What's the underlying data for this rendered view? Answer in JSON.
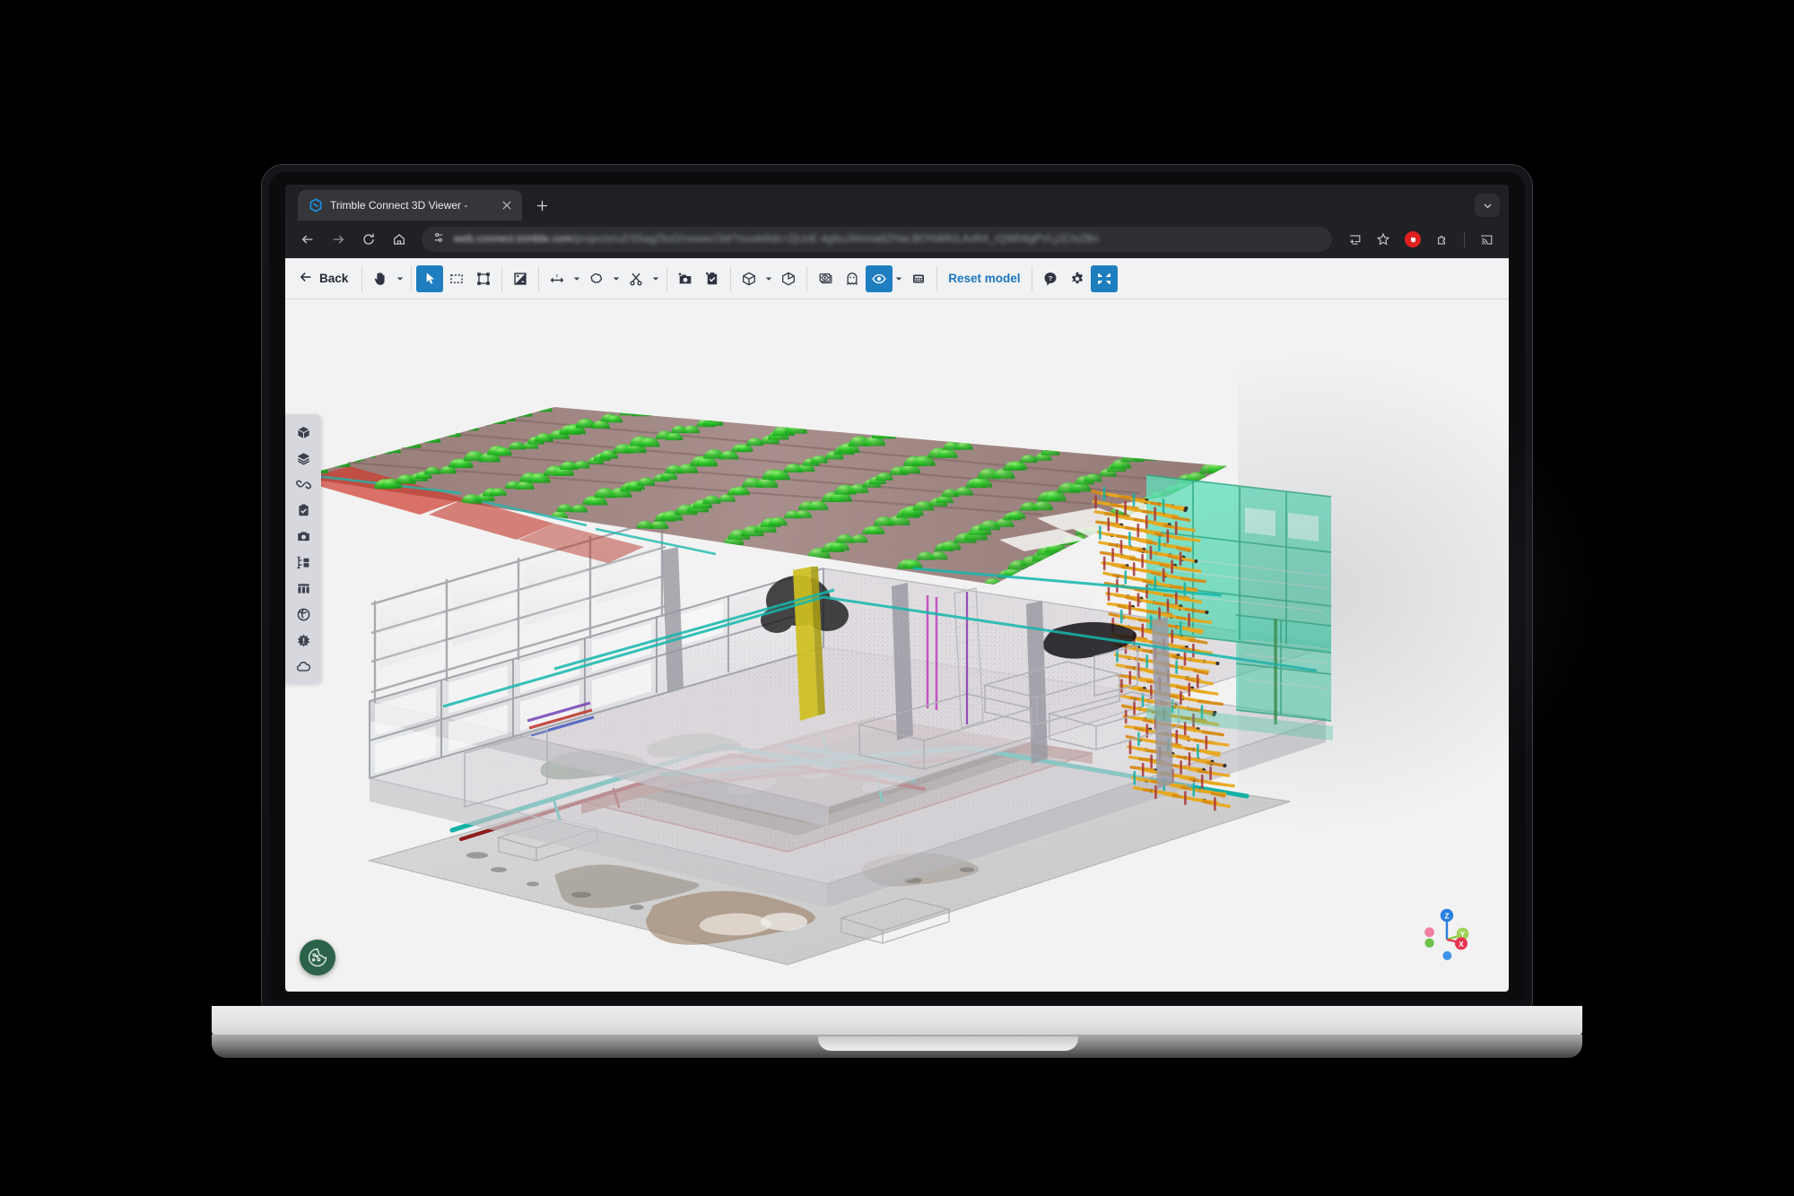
{
  "browser": {
    "tab": {
      "title": "Trimble Connect 3D Viewer -",
      "favicon_icon": "trimble-logo-icon",
      "close_icon": "close-icon"
    },
    "new_tab_label": "+",
    "tab_search_icon": "chevron-down-icon",
    "nav": {
      "back_icon": "arrow-left-icon",
      "forward_icon": "arrow-right-icon",
      "reload_icon": "reload-icon",
      "home_icon": "home-icon"
    },
    "address": {
      "site_settings_icon": "tune-icon",
      "url_domain": "web.connect.trimble.com",
      "url_path": "/projects/uZr55agZbzD/viewer/3d/?modelIds=ZjUoE-4g6uJAhmia6ZHaLBO%WKiLAvRA_rQWh6gPVLjJZJsZBn",
      "blurred": true
    },
    "actions": {
      "install_icon": "install-app-icon",
      "bookmark_icon": "star-icon",
      "extension_badge_icon": "extension-alert-icon",
      "extensions_icon": "puzzle-piece-icon",
      "cast_icon": "cast-icon"
    }
  },
  "toolbar": {
    "back_label": "Back",
    "back_icon": "arrow-left-icon",
    "reset_label": "Reset model",
    "groups": [
      {
        "name": "navigation",
        "items": [
          {
            "icon": "pan-hand-icon",
            "name": "pan-tool",
            "active": false,
            "caret": true
          }
        ]
      },
      {
        "name": "selection",
        "items": [
          {
            "icon": "cursor-arrow-icon",
            "name": "select-tool",
            "active": true,
            "caret": false
          },
          {
            "icon": "marquee-select-icon",
            "name": "rectangle-select-tool",
            "active": false,
            "caret": false
          },
          {
            "icon": "bounding-box-select-icon",
            "name": "box-select-tool",
            "active": false,
            "caret": false
          }
        ]
      },
      {
        "name": "appearance",
        "items": [
          {
            "icon": "contrast-icon",
            "name": "contrast-tool",
            "active": false,
            "caret": false
          }
        ]
      },
      {
        "name": "annotate",
        "items": [
          {
            "icon": "measure-icon",
            "name": "measure-tool",
            "active": false,
            "caret": true
          },
          {
            "icon": "markup-cloud-icon",
            "name": "markup-tool",
            "active": false,
            "caret": true
          },
          {
            "icon": "scissors-icon",
            "name": "clip-tool",
            "active": false,
            "caret": true
          }
        ]
      },
      {
        "name": "capture",
        "items": [
          {
            "icon": "add-photo-icon",
            "name": "create-view-button",
            "active": false,
            "caret": false
          },
          {
            "icon": "add-todo-icon",
            "name": "create-todo-button",
            "active": false,
            "caret": false
          }
        ]
      },
      {
        "name": "display-mode",
        "items": [
          {
            "icon": "wireframe-cube-icon",
            "name": "render-mode-tool",
            "active": false,
            "caret": true
          },
          {
            "icon": "solid-cube-icon",
            "name": "solid-mode-button",
            "active": false,
            "caret": false
          }
        ]
      },
      {
        "name": "visibility",
        "items": [
          {
            "icon": "layers-eye-icon",
            "name": "isolate-button",
            "active": false,
            "caret": false
          },
          {
            "icon": "ghost-icon",
            "name": "transparency-button",
            "active": false,
            "caret": false
          },
          {
            "icon": "eye-icon",
            "name": "visibility-tool",
            "active": true,
            "caret": true
          },
          {
            "icon": "grid-icon",
            "name": "point-cloud-grid-button",
            "active": false,
            "caret": false
          }
        ]
      },
      {
        "name": "utilities",
        "items": [
          {
            "icon": "help-icon",
            "name": "help-button",
            "active": false,
            "caret": false
          },
          {
            "icon": "gear-icon",
            "name": "settings-button",
            "active": false,
            "caret": false
          },
          {
            "icon": "fit-to-view-icon",
            "name": "fit-to-view-button",
            "active": true,
            "caret": false
          }
        ]
      }
    ]
  },
  "sidebar": {
    "items": [
      {
        "icon": "cube-icon",
        "name": "models-panel"
      },
      {
        "icon": "layers-icon",
        "name": "layers-panel"
      },
      {
        "icon": "link-icon",
        "name": "links-panel"
      },
      {
        "icon": "clipboard-check-icon",
        "name": "todos-panel"
      },
      {
        "icon": "camera-icon",
        "name": "views-panel"
      },
      {
        "icon": "folder-tree-icon",
        "name": "structure-panel"
      },
      {
        "icon": "table-columns-icon",
        "name": "properties-panel"
      },
      {
        "icon": "orbit-sphere-icon",
        "name": "clash-panel"
      },
      {
        "icon": "burst-icon",
        "name": "explode-panel"
      },
      {
        "icon": "cloud-icon",
        "name": "point-cloud-panel"
      }
    ]
  },
  "viewer": {
    "cookie_button_icon": "cookie-icon",
    "background_color": "#f2f2f2",
    "gizmo": {
      "axes": [
        {
          "label": "Z",
          "color": "#2a7de1"
        },
        {
          "label": "Y",
          "color": "#8dc63f"
        },
        {
          "label": "X",
          "color": "#e8344e"
        }
      ],
      "negative_dots": [
        {
          "color": "#f2809f"
        },
        {
          "color": "#6cc24a"
        },
        {
          "color": "#3d94e8"
        }
      ]
    },
    "model": {
      "description": "Registered point-cloud scan merged with translucent BIM structural model of a multi-storey industrial building, cut-away isometric view",
      "features": [
        "green dome-shaped roof scan artefacts",
        "translucent teal curtain wall panels",
        "orange and yellow MEP pipe runs",
        "grey structural steel frames and columns",
        "sunken red-brick pit with teal and dark red pipes",
        "grey concrete ground slab"
      ],
      "palette": {
        "green_domes": "#2ec42e",
        "teal_panel": "#4fd8b0",
        "orange_mep": "#e8a219",
        "yellow_column": "#d8c219",
        "grey_structure": "#b8bcc0",
        "pit_red": "#b4605a",
        "pipe_teal": "#13b5a8",
        "pipe_red": "#9c1f1f",
        "slab_grey": "#c9c9c9"
      }
    }
  }
}
